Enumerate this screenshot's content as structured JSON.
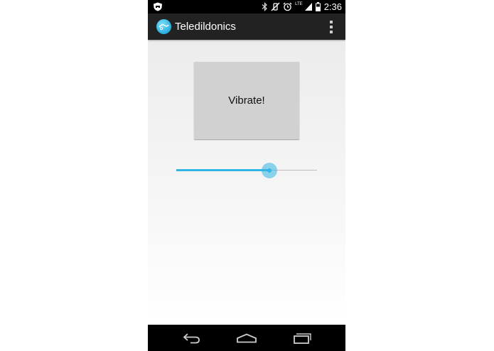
{
  "status_bar": {
    "network_type": "LTE",
    "time": "2:36",
    "icons": [
      "notification-shield-icon",
      "bluetooth-icon",
      "vibrate-off-icon",
      "alarm-icon",
      "signal-icon",
      "battery-icon"
    ]
  },
  "action_bar": {
    "title": "Teledildonics",
    "app_icon": "app-logo-icon",
    "overflow_icon": "overflow-menu-icon"
  },
  "main": {
    "vibrate_button_label": "Vibrate!",
    "seekbar": {
      "value_fraction": 0.66
    }
  },
  "nav_bar": {
    "icons": [
      "back-icon",
      "home-icon",
      "recent-apps-icon"
    ]
  },
  "colors": {
    "accent": "#33b5e5",
    "action_bar": "#222222",
    "button": "#d1d1d1"
  }
}
